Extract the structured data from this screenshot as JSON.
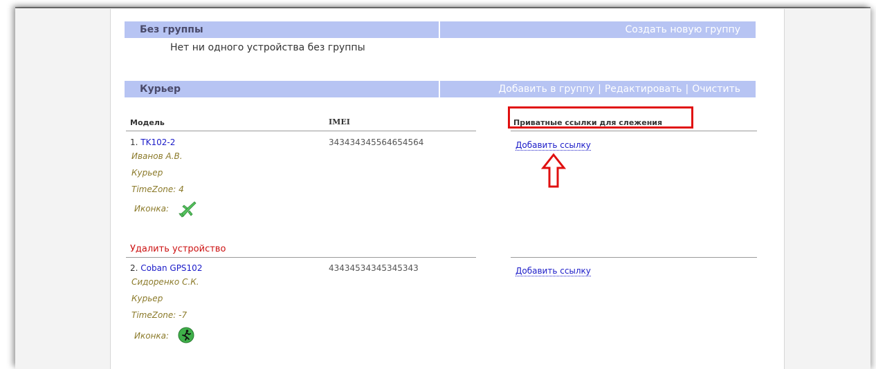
{
  "groups": {
    "no_group": {
      "title": "Без группы",
      "create_link": "Создать новую группу",
      "empty_text": "Нет ни одного устройства без группы"
    },
    "courier": {
      "title": "Курьер",
      "actions": [
        "Добавить в группу",
        "Редактировать",
        "Очистить"
      ],
      "separator": "|"
    }
  },
  "table": {
    "headers": {
      "model": "Модель",
      "imei": "IMEI",
      "links": "Приватные ссылки для слежения"
    }
  },
  "devices": [
    {
      "index": "1.",
      "model": "TK102-2",
      "owner": "Иванов А.В.",
      "group": "Курьер",
      "timezone": "TimeZone: 4",
      "icon_label": "Иконка:",
      "icon": "airplane-icon",
      "imei": "343434345564654564",
      "add_link": "Добавить ссылку",
      "delete": "Удалить устройство"
    },
    {
      "index": "2.",
      "model": "Coban GPS102",
      "owner": "Сидоренко С.К.",
      "group": "Курьер",
      "timezone": "TimeZone: -7",
      "icon_label": "Иконка:",
      "icon": "runner-icon",
      "imei": "43434534345345343",
      "add_link": "Добавить ссылку"
    }
  ],
  "annotations": {
    "highlight_color": "#e01010",
    "arrow": "up-arrow-icon"
  }
}
